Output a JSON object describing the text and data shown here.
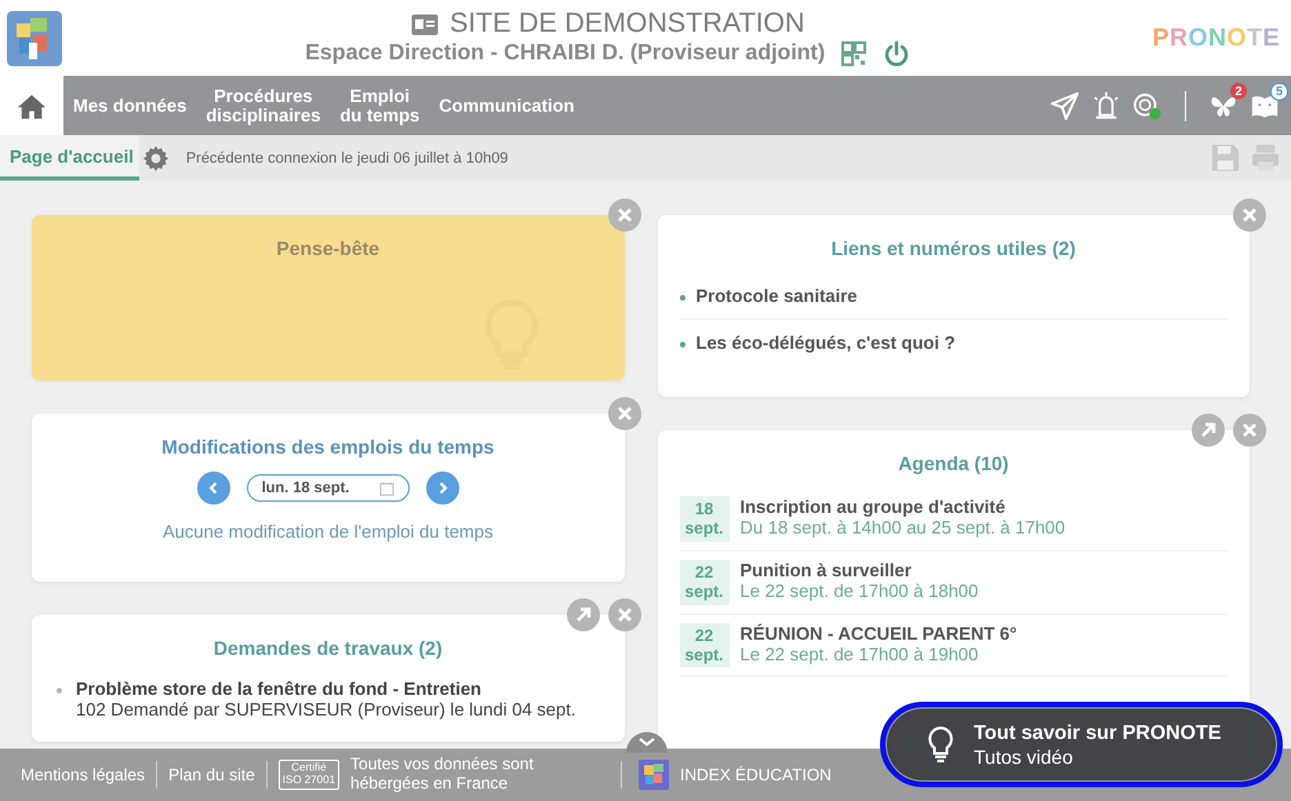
{
  "header": {
    "title": "SITE DE DEMONSTRATION",
    "subtitle": "Espace Direction - CHRAIBI D. (Proviseur adjoint)",
    "brand": "PRONOTE"
  },
  "nav": {
    "items": [
      {
        "kind": "home",
        "selected": true
      },
      {
        "kind": "text",
        "label": "Mes données",
        "selected": false
      },
      {
        "kind": "text",
        "label": "Procédures\ndisciplinaires",
        "selected": false
      },
      {
        "kind": "text",
        "label": "Emploi\ndu temps",
        "selected": false
      },
      {
        "kind": "text",
        "label": "Communication",
        "selected": false
      }
    ],
    "badges": {
      "messages": "2",
      "notebook": "5"
    }
  },
  "subbar": {
    "tab": {
      "label": "Page d'accueil",
      "selected": true
    },
    "last_login": "Précédente connexion le jeudi 06 juillet à 10h09"
  },
  "columns": [
    [
      {
        "kind": "note",
        "title": "Pense-bête",
        "expandable": false
      },
      {
        "kind": "timetable",
        "title": "Modifications des emplois du temps",
        "expandable": false,
        "date": "lun. 18 sept.",
        "message": "Aucune modification de l'emploi du temps"
      },
      {
        "kind": "requests",
        "title": "Demandes de travaux (2)",
        "expandable": true,
        "items": [
          {
            "title": "Problème store de la fenêtre du fond - Entretien",
            "detail": "102 Demandé par SUPERVISEUR (Proviseur) le lundi 04 sept."
          }
        ]
      }
    ],
    [
      {
        "kind": "links",
        "title": "Liens et numéros utiles (2)",
        "expandable": false,
        "items": [
          "Protocole sanitaire",
          "Les éco-délégués, c'est quoi ?"
        ]
      },
      {
        "kind": "agenda",
        "title": "Agenda (10)",
        "expandable": true,
        "events": [
          {
            "day": "18",
            "month": "sept.",
            "title": "Inscription au groupe d'activité",
            "detail": "Du 18 sept. à 14h00 au 25 sept. à 17h00"
          },
          {
            "day": "22",
            "month": "sept.",
            "title": "Punition à surveiller",
            "detail": "Le 22 sept. de 17h00 à 18h00"
          },
          {
            "day": "22",
            "month": "sept.",
            "title": "RÉUNION - ACCUEIL PARENT 6°",
            "detail": "Le 22 sept. de 17h00 à 19h00"
          }
        ]
      }
    ]
  ],
  "footer": {
    "links": [
      "Mentions légales",
      "Plan du site"
    ],
    "cert": [
      "Certifié",
      "ISO 27001"
    ],
    "hosting": "Toutes vos données sont hébergées en France",
    "company": "INDEX ÉDUCATION"
  },
  "tutorial": {
    "title": "Tout savoir sur PRONOTE",
    "subtitle": "Tutos vidéo"
  }
}
